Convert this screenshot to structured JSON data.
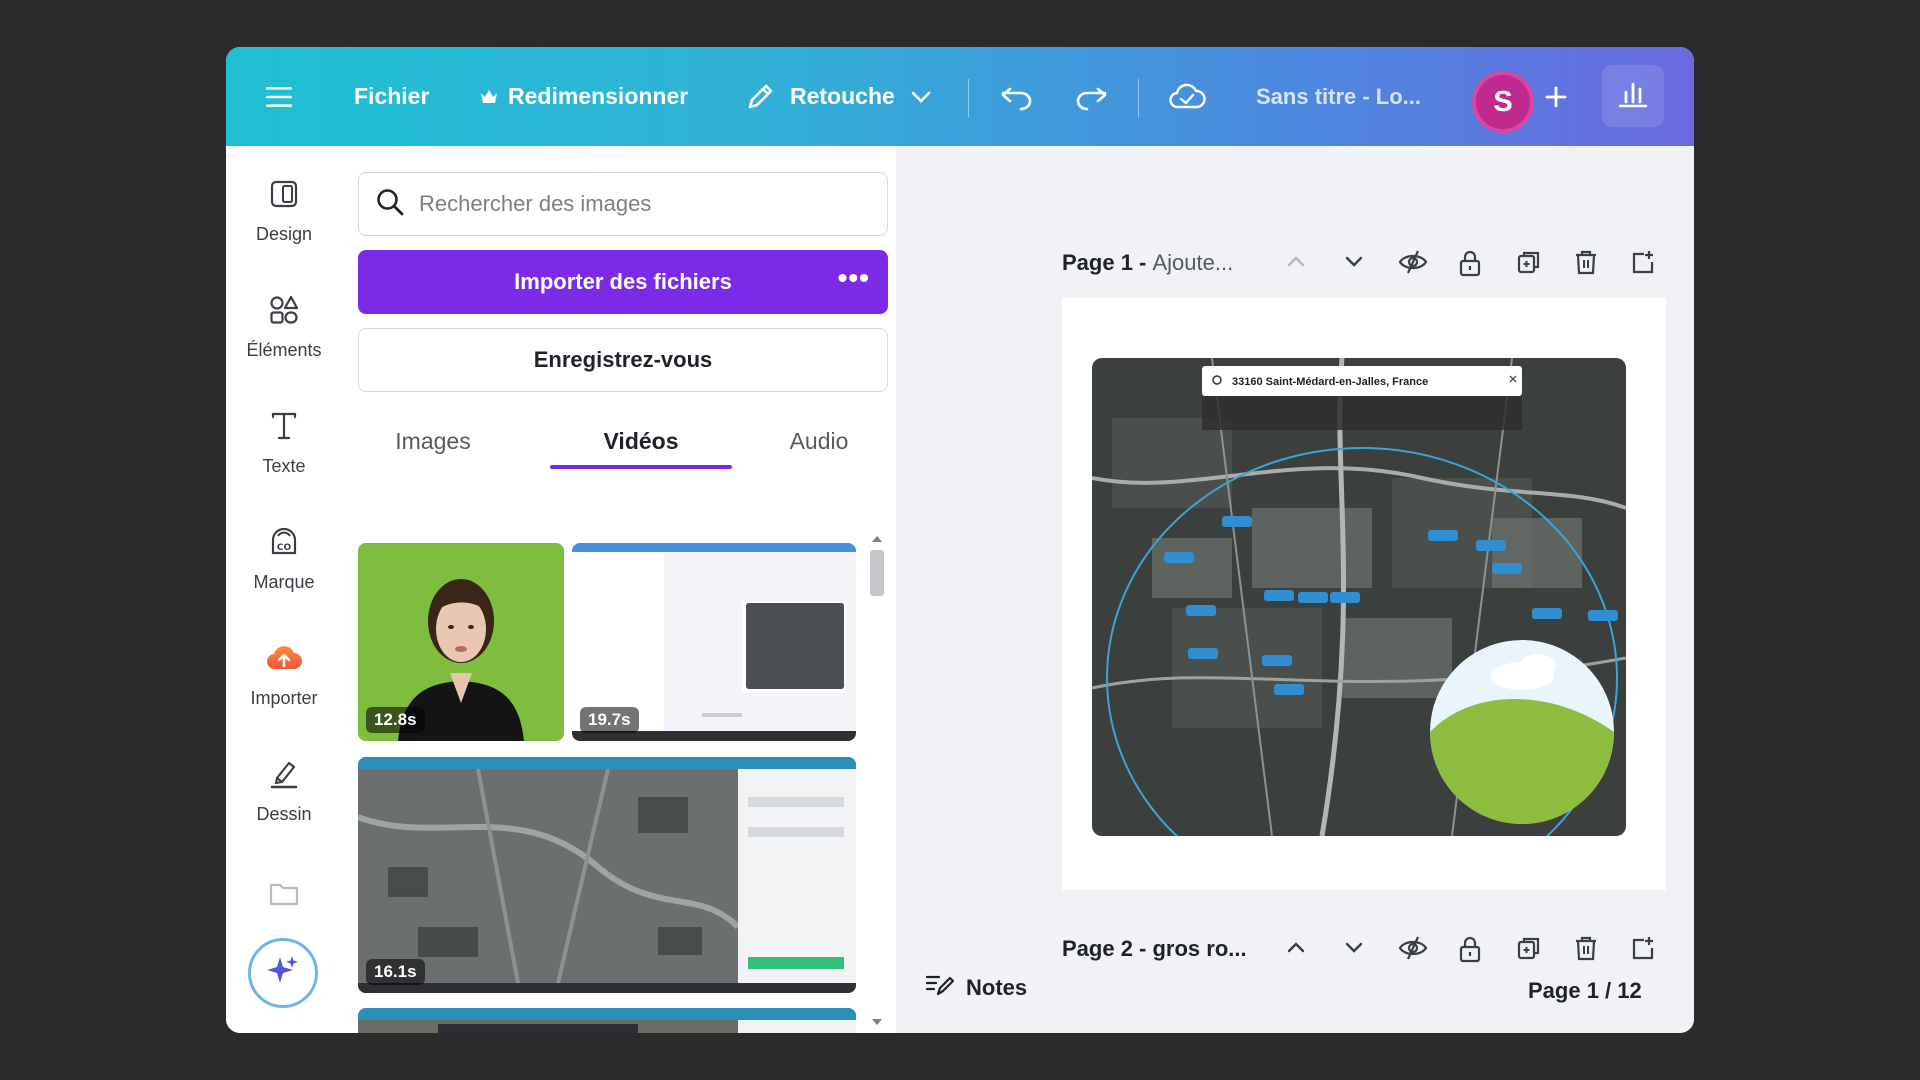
{
  "topbar": {
    "file_label": "Fichier",
    "resize_label": "Redimensionner",
    "edit_label": "Retouche",
    "doc_title": "Sans titre - Lo...",
    "avatar_initial": "S",
    "gradient": [
      "#1fc0d4",
      "#6a6ae0"
    ]
  },
  "rail": {
    "items": [
      {
        "label": "Design",
        "icon": "design-icon"
      },
      {
        "label": "Éléments",
        "icon": "elements-icon"
      },
      {
        "label": "Texte",
        "icon": "text-icon"
      },
      {
        "label": "Marque",
        "icon": "brand-icon"
      },
      {
        "label": "Importer",
        "icon": "upload-cloud-icon"
      },
      {
        "label": "Dessin",
        "icon": "draw-icon"
      }
    ]
  },
  "panel": {
    "search_placeholder": "Rechercher des images",
    "upload_label": "Importer des fichiers",
    "register_label": "Enregistrez-vous",
    "tabs": [
      "Images",
      "Vidéos",
      "Audio"
    ],
    "active_tab": "Vidéos",
    "videos": [
      {
        "duration": "12.8s"
      },
      {
        "duration": "19.7s"
      },
      {
        "duration": "16.1s"
      },
      {
        "duration": ""
      }
    ]
  },
  "canvas": {
    "page1_number": "Page 1 -",
    "page1_name": "Ajoute...",
    "page2_title": "Page 2 - gros ro...",
    "map_search_text": "33160 Saint-Médard-en-Jalles, France",
    "notes_label": "Notes",
    "page_counter": "Page 1 / 12"
  },
  "colors": {
    "accent_purple": "#7d2ae8",
    "avatar": "#c02a8e"
  }
}
